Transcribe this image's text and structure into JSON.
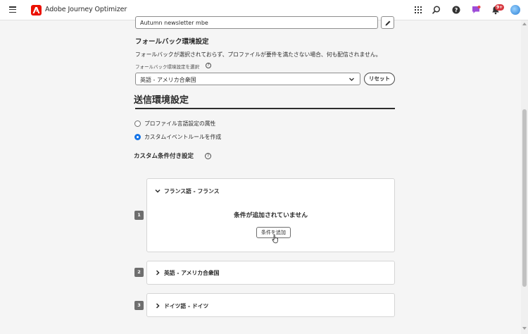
{
  "app": {
    "title": "Adobe Journey Optimizer",
    "notification_count": "9+"
  },
  "icons": {
    "menu": "hamburger-icon",
    "logo": "adobe-logo",
    "apps": "grid-icon",
    "search": "search-icon",
    "help": "help-icon",
    "feedback": "chat-icon",
    "notifications": "bell-icon",
    "avatar": "user-avatar"
  },
  "name_field": {
    "value": "Autumn newsletter mbe"
  },
  "fallback": {
    "heading": "フォールバック環境設定",
    "description": "フォールバックが選択されておらず、プロファイルが要件を満たさない場合、何も配信されません。",
    "select_label": "フォールバック環境設定を選択",
    "selected_value": "英語 - アメリカ合衆国",
    "reset_label": "リセット"
  },
  "send": {
    "heading": "送信環境設定",
    "options": [
      {
        "label": "プロファイル言語設定の属性",
        "checked": false
      },
      {
        "label": "カスタムイベントルールを作成",
        "checked": true
      }
    ]
  },
  "custom": {
    "heading": "カスタム条件付き設定",
    "items": [
      {
        "number": "1",
        "title": "フランス語 - フランス",
        "expanded": true,
        "empty_text": "条件が追加されていません",
        "add_label": "条件を追加"
      },
      {
        "number": "2",
        "title": "英語 - アメリカ合衆国",
        "expanded": false
      },
      {
        "number": "3",
        "title": "ドイツ語 - ドイツ",
        "expanded": false
      }
    ]
  },
  "colors": {
    "accent": "#1473e6",
    "brand": "#eb1000",
    "badge": "#d7373f"
  }
}
